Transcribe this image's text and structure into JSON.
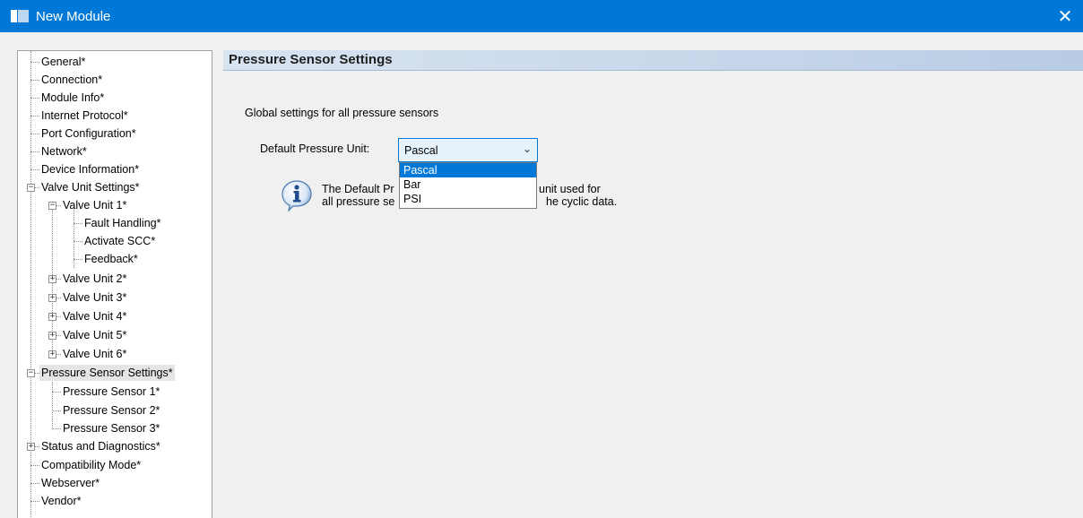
{
  "window": {
    "title": "New Module",
    "close_glyph": "✕"
  },
  "tree": {
    "items": [
      {
        "label": "General*"
      },
      {
        "label": "Connection*"
      },
      {
        "label": "Module Info*"
      },
      {
        "label": "Internet Protocol*"
      },
      {
        "label": "Port Configuration*"
      },
      {
        "label": "Network*"
      },
      {
        "label": "Device Information*"
      },
      {
        "label": "Valve Unit Settings*"
      },
      {
        "label": "Valve Unit 1*"
      },
      {
        "label": "Fault Handling*"
      },
      {
        "label": "Activate SCC*"
      },
      {
        "label": "Feedback*"
      },
      {
        "label": "Valve Unit 2*"
      },
      {
        "label": "Valve Unit 3*"
      },
      {
        "label": "Valve Unit 4*"
      },
      {
        "label": "Valve Unit 5*"
      },
      {
        "label": "Valve Unit 6*"
      },
      {
        "label": "Pressure Sensor Settings*"
      },
      {
        "label": "Pressure Sensor 1*"
      },
      {
        "label": "Pressure Sensor 2*"
      },
      {
        "label": "Pressure Sensor 3*"
      },
      {
        "label": "Status and Diagnostics*"
      },
      {
        "label": "Compatibility Mode*"
      },
      {
        "label": "Webserver*"
      },
      {
        "label": "Vendor*"
      }
    ],
    "selected": "Pressure Sensor Settings*"
  },
  "pane": {
    "header": "Pressure Sensor Settings",
    "global_text": "Global settings for all pressure sensors",
    "unit_label": "Default Pressure Unit:",
    "combo": {
      "value": "Pascal",
      "arrow": "⌄"
    },
    "dropdown": {
      "options": [
        "Pascal",
        "Bar",
        "PSI"
      ],
      "selected": "Pascal"
    },
    "info": {
      "icon": "info-icon",
      "line1_left": "The Default Pr",
      "line1_right": "unit used for",
      "line2_left": "all pressure se",
      "line2_right": "he cyclic data."
    }
  },
  "colors": {
    "titlebar": "#0078d7",
    "selection": "#0078d7"
  }
}
